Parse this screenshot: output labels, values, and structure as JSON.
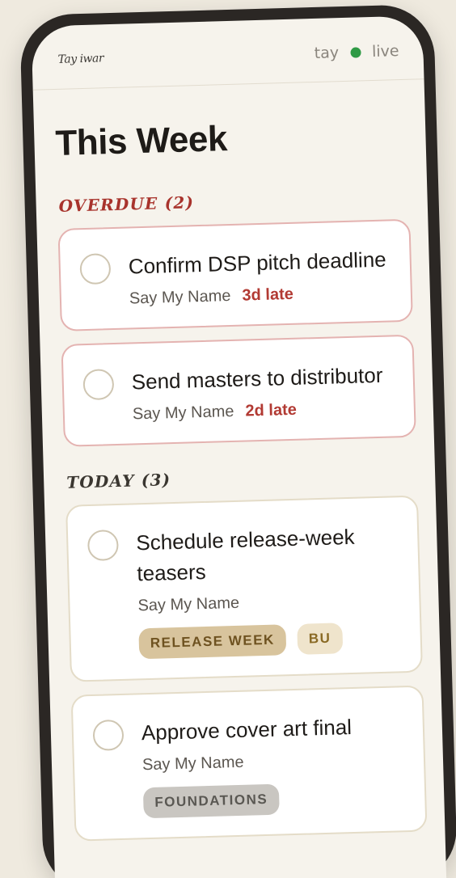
{
  "header": {
    "signature": "Tay iwar",
    "user": "tay",
    "status": "live",
    "colors": {
      "live": "#2f9a45"
    }
  },
  "page": {
    "title": "This Week"
  },
  "sections": {
    "overdue": {
      "heading": "OVERDUE (2)",
      "items": [
        {
          "title": "Confirm DSP pitch deadline",
          "project": "Say My Name",
          "late": "3d late"
        },
        {
          "title": "Send masters to distributor",
          "project": "Say My Name",
          "late": "2d late"
        }
      ]
    },
    "today": {
      "heading": "TODAY (3)",
      "items": [
        {
          "title": "Schedule release-week teasers",
          "project": "Say My Name",
          "tags": [
            "RELEASE WEEK",
            "BU"
          ]
        },
        {
          "title": "Approve cover art final",
          "project": "Say My Name",
          "tags": [
            "FOUNDATIONS"
          ]
        }
      ]
    }
  },
  "colors": {
    "overdue_accent": "#a8332c",
    "late_text": "#b23a33",
    "background": "#f6f3ec"
  }
}
